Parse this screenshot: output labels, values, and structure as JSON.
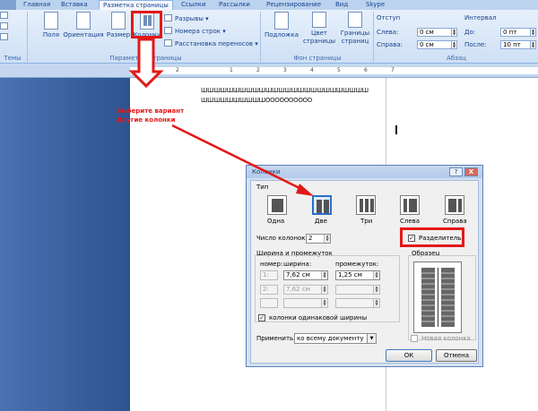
{
  "ribbon": {
    "tabs": [
      "Главная",
      "Вставка",
      "Разметка страницы",
      "Ссылки",
      "Рассылки",
      "Рецензирование",
      "Вид",
      "Skype"
    ],
    "active_tab_index": 2,
    "themes_label": "Темы",
    "fields_label": "Поля",
    "orientation_label": "Ориентация",
    "size_label": "Размер",
    "columns_label": "Колонки",
    "breaks_label": "Разрывы",
    "line_numbers_label": "Номера строк",
    "hyphenation_label": "Расстановка переносов",
    "page_setup_group": "Параметры страницы",
    "watermark_label": "Подложка",
    "page_color_label": "Цвет страницы",
    "page_borders_label": "Границы страниц",
    "page_background_group": "Фон страницы",
    "indent_header": "Отступ",
    "indent_left_label": "Слева:",
    "indent_left_value": "0 см",
    "indent_right_label": "Справа:",
    "indent_right_value": "0 см",
    "spacing_header": "Интервал",
    "spacing_before_label": "До:",
    "spacing_before_value": "0 пт",
    "spacing_after_label": "После:",
    "spacing_after_value": "10 пт",
    "paragraph_group": "Абзац"
  },
  "ruler": {
    "numbers": [
      "1",
      "2",
      "1",
      "2",
      "3",
      "4",
      "5",
      "6",
      "7"
    ]
  },
  "document": {
    "line1": "ШШШШШШШШШШШШШШШШШШШШШШШШШШ",
    "line2": "ШШШШШШШШШШОООООООООО"
  },
  "annotation": {
    "line1": "Выберите вариант",
    "line2": "Другие колонки",
    "color": "#e31818"
  },
  "dialog": {
    "title": "Колонки",
    "help_button": "?",
    "close_button": "X",
    "type_label": "Тип",
    "presets": [
      "Одна",
      "Две",
      "Три",
      "Слева",
      "Справа"
    ],
    "selected_preset": "Две",
    "columns_count_label": "Число колонок:",
    "columns_count_value": "2",
    "separator_label": "Разделитель",
    "separator_checked": true,
    "width_spacing_label": "Ширина и промежуток",
    "col_number_header": "номер:",
    "col_width_header": "ширина:",
    "col_spacing_header": "промежуток:",
    "rows": [
      {
        "number": "1:",
        "width": "7,62 см",
        "spacing": "1,25 см"
      },
      {
        "number": "2:",
        "width": "7,62 см",
        "spacing": ""
      },
      {
        "number": "",
        "width": "",
        "spacing": ""
      }
    ],
    "equal_width_label": "колонки одинаковой ширины",
    "equal_width_checked": true,
    "sample_label": "Образец",
    "apply_label": "Применить:",
    "apply_value": "ко всему документу",
    "new_column_label": "Новая колонка",
    "new_column_checked": false,
    "ok_label": "ОК",
    "cancel_label": "Отмена"
  }
}
